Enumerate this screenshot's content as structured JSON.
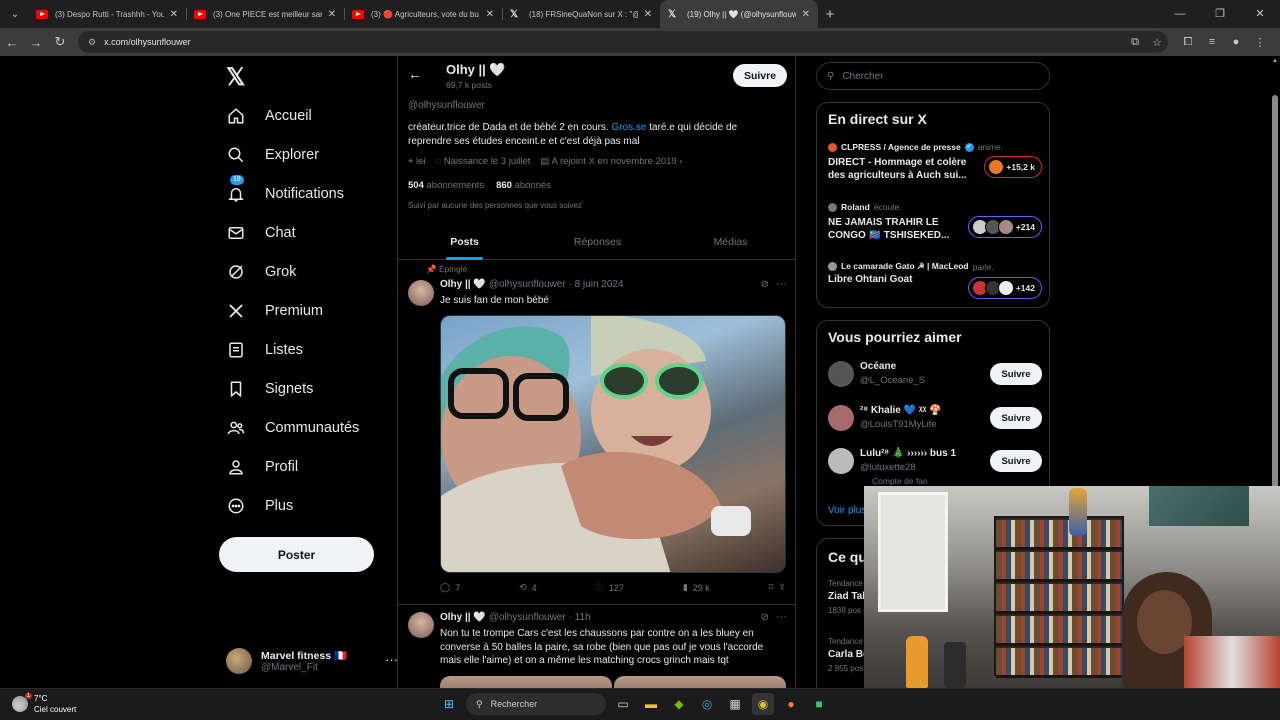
{
  "browser": {
    "tabs": [
      {
        "title": "(3) Despo Rutti - Trashhh - YouT",
        "icon": "youtube-icon",
        "active": false
      },
      {
        "title": "(3) One PIECE est meilleur sans",
        "icon": "youtube-icon",
        "active": false
      },
      {
        "title": "(3) 🔴 Agriculteurs, vote du bu",
        "icon": "youtube-icon",
        "active": false
      },
      {
        "title": "(18) FRSineQuaNon sur X : \"@Ti",
        "icon": "x-icon",
        "active": false
      },
      {
        "title": "(19) Olhy || 🤍 (@olhysunflouw",
        "icon": "x-icon",
        "active": true
      }
    ],
    "url": "x.com/olhysunflouwer"
  },
  "leftnav": {
    "items": [
      {
        "label": "Accueil",
        "icon": "home-icon"
      },
      {
        "label": "Explorer",
        "icon": "search-icon"
      },
      {
        "label": "Notifications",
        "icon": "bell-icon",
        "badge": "19"
      },
      {
        "label": "Chat",
        "icon": "mail-icon"
      },
      {
        "label": "Grok",
        "icon": "grok-icon"
      },
      {
        "label": "Premium",
        "icon": "x-icon"
      },
      {
        "label": "Listes",
        "icon": "list-icon"
      },
      {
        "label": "Signets",
        "icon": "bookmark-icon"
      },
      {
        "label": "Communautés",
        "icon": "people-icon"
      },
      {
        "label": "Profil",
        "icon": "person-icon"
      },
      {
        "label": "Plus",
        "icon": "more-circle-icon"
      }
    ],
    "post_label": "Poster",
    "account": {
      "name": "Marvel fitness 🇫🇷",
      "handle": "@Marvel_Fit"
    }
  },
  "profile": {
    "name": "Olhy || 🤍",
    "posts_count": "69,7 k posts",
    "follow_label": "Suivre",
    "handle": "@olhysunflouwer",
    "bio_before": "créateur.trice de Dada et de bébé 2 en cours. ",
    "bio_link": "Gros.se",
    "bio_after": " taré.e qui décide de reprendre ses études enceint.e et c'est déjà pas mal",
    "location": "lei",
    "birthday": "Naissance le 3 juillet",
    "joined": "A rejoint X en novembre 2019",
    "following_count": "504",
    "following_label": "abonnements",
    "followers_count": "860",
    "followers_label": "abonnés",
    "followed_by": "Suivi par aucune des personnes que vous suivez",
    "tabs": [
      "Posts",
      "Réponses",
      "Médias"
    ]
  },
  "tweets": [
    {
      "pinned_label": "Épinglé",
      "name": "Olhy || 🤍",
      "handle": "@olhysunflouwer",
      "date": "· 8 juin 2024",
      "text": "Je suis fan de mon bébé",
      "replies": "7",
      "retweets": "4",
      "likes": "127",
      "views": "29 k"
    },
    {
      "name": "Olhy || 🤍",
      "handle": "@olhysunflouwer",
      "date": "· 11h",
      "text": "Non tu te trompe Cars c'est les chaussons par contre on a les bluey en converse à 50 balles la paire, sa robe (bien que pas ouf je vous l'accorde mais elle l'aime) et on a même les matching crocs grinch mais tqt"
    }
  ],
  "right": {
    "search_placeholder": "Chercher",
    "live_title": "En direct sur X",
    "live": [
      {
        "host": "CLPRESS / Agence de presse",
        "status": "anime.",
        "title": "DIRECT - Hommage et colère des agriculteurs à Auch sui...",
        "count": "+15,2 k",
        "color": "#e0245e"
      },
      {
        "host": "Roland",
        "status": "écoute.",
        "title": "NE JAMAIS TRAHIR LE CONGO 🇨🇩 TSHISEKED...",
        "count": "+214",
        "color": "#7856ff"
      },
      {
        "host": "Le camarade Gato ☭ | MacLeod",
        "status": "parle.",
        "title": "Libre Ohtani Goat",
        "count": "+142",
        "color": "#7856ff"
      }
    ],
    "suggest_title": "Vous pourriez aimer",
    "suggest": [
      {
        "name": "Océane",
        "handle": "@L_Oceane_S",
        "button": "Suivre"
      },
      {
        "name": "²⁸ Khalie 💙 ᵡᵡ 🍄",
        "handle": "@LouisT91MyLife",
        "button": "Suivre"
      },
      {
        "name": "Lulu²⁸ 🎄 ›››››› bus 1",
        "handle": "@luluxette28",
        "button": "Suivre",
        "extra": "Compte de fan"
      }
    ],
    "voir_plus": "Voir plus",
    "trends_title": "Ce qu",
    "trends": [
      {
        "category": "Tendance",
        "name": "Ziad Tal",
        "count": "1838 pos"
      },
      {
        "category": "Tendance",
        "name": "Carla Bu",
        "count": "2 955 pos"
      }
    ]
  },
  "taskbar": {
    "temperature": "7°C",
    "weather": "Ciel couvert",
    "weather_badge": "1",
    "search_label": "Rechercher"
  }
}
